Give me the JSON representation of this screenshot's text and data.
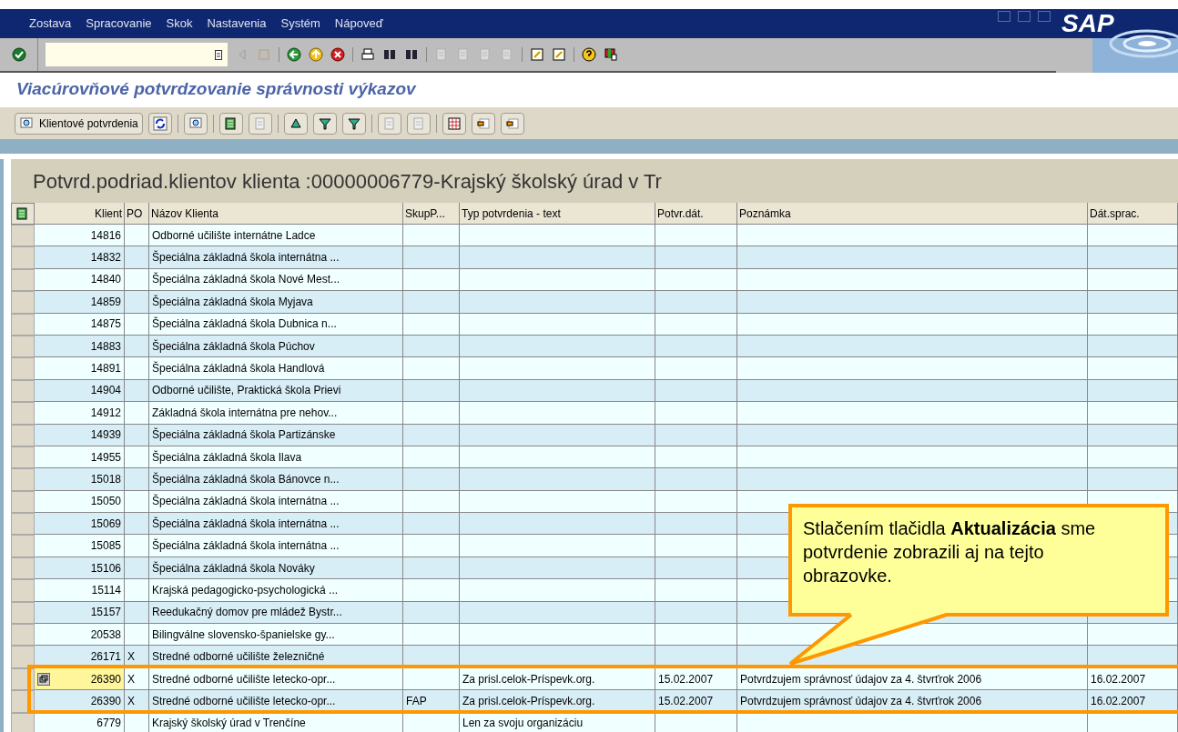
{
  "menu_bar": {
    "items": [
      "Zostava",
      "Spracovanie",
      "Skok",
      "Nastavenia",
      "Systém",
      "Nápoveď"
    ]
  },
  "logo": {
    "text": "SAP"
  },
  "screen_title": "Viacúrovňové potvrdzovanie správnosti výkazov",
  "app_toolbar": {
    "button_label": "Klientové potvrdenia"
  },
  "grid": {
    "title": "Potvrd.podriad.klientov klienta :00000006779-Krajský školský úrad v Tr",
    "columns": [
      "Klient",
      "PO",
      "Názov Klienta",
      "SkupP...",
      "Typ potvrdenia - text",
      "Potvr.dát.",
      "Poznámka",
      "Dát.sprac."
    ],
    "rows": [
      {
        "cells": [
          "14816",
          "",
          "Odborné učilište internátne Ladce",
          "",
          "",
          "",
          "",
          ""
        ],
        "current": false
      },
      {
        "cells": [
          "14832",
          "",
          "Špeciálna základná škola internátna ...",
          "",
          "",
          "",
          "",
          ""
        ],
        "current": false
      },
      {
        "cells": [
          "14840",
          "",
          "Špeciálna základná škola Nové Mest...",
          "",
          "",
          "",
          "",
          ""
        ],
        "current": false
      },
      {
        "cells": [
          "14859",
          "",
          "Špeciálna základná škola Myjava",
          "",
          "",
          "",
          "",
          ""
        ],
        "current": false
      },
      {
        "cells": [
          "14875",
          "",
          "Špeciálna základná škola Dubnica n...",
          "",
          "",
          "",
          "",
          ""
        ],
        "current": false
      },
      {
        "cells": [
          "14883",
          "",
          "Špeciálna základná škola Púchov",
          "",
          "",
          "",
          "",
          ""
        ],
        "current": false
      },
      {
        "cells": [
          "14891",
          "",
          "Špeciálna základná škola Handlová",
          "",
          "",
          "",
          "",
          ""
        ],
        "current": false
      },
      {
        "cells": [
          "14904",
          "",
          "Odborné učilište, Praktická škola Prievi",
          "",
          "",
          "",
          "",
          ""
        ],
        "current": false
      },
      {
        "cells": [
          "14912",
          "",
          "Základná škola internátna pre nehov...",
          "",
          "",
          "",
          "",
          ""
        ],
        "current": false
      },
      {
        "cells": [
          "14939",
          "",
          "Špeciálna základná škola Partizánske",
          "",
          "",
          "",
          "",
          ""
        ],
        "current": false
      },
      {
        "cells": [
          "14955",
          "",
          "Špeciálna základná škola Ilava",
          "",
          "",
          "",
          "",
          ""
        ],
        "current": false
      },
      {
        "cells": [
          "15018",
          "",
          "Špeciálna základná škola Bánovce n...",
          "",
          "",
          "",
          "",
          ""
        ],
        "current": false
      },
      {
        "cells": [
          "15050",
          "",
          "Špeciálna základná škola internátna ...",
          "",
          "",
          "",
          "",
          ""
        ],
        "current": false
      },
      {
        "cells": [
          "15069",
          "",
          "Špeciálna základná škola internátna ...",
          "",
          "",
          "",
          "",
          ""
        ],
        "current": false
      },
      {
        "cells": [
          "15085",
          "",
          "Špeciálna základná škola internátna ...",
          "",
          "",
          "",
          "",
          ""
        ],
        "current": false
      },
      {
        "cells": [
          "15106",
          "",
          "Špeciálna základná škola Nováky",
          "",
          "",
          "",
          "",
          ""
        ],
        "current": false
      },
      {
        "cells": [
          "15114",
          "",
          "Krajská pedagogicko-psychologická ...",
          "",
          "",
          "",
          "",
          ""
        ],
        "current": false
      },
      {
        "cells": [
          "15157",
          "",
          "Reedukačný domov pre mládež Bystr...",
          "",
          "",
          "",
          "",
          ""
        ],
        "current": false
      },
      {
        "cells": [
          "20538",
          "",
          "Bilingválne slovensko-španielske gy...",
          "",
          "",
          "",
          "",
          ""
        ],
        "current": false
      },
      {
        "cells": [
          "26171",
          "X",
          "Stredné odborné učilište železničné",
          "",
          "",
          "",
          "",
          ""
        ],
        "current": false
      },
      {
        "cells": [
          "26390",
          "X",
          "Stredné odborné učilište letecko-opr...",
          "",
          "Za prisl.celok-Príspevk.org.",
          "15.02.2007",
          "Potvrdzujem správnosť údajov za 4. štvrťrok 2006",
          "16.02.2007"
        ],
        "current": true
      },
      {
        "cells": [
          "26390",
          "X",
          "Stredné odborné učilište letecko-opr...",
          "FAP",
          "Za prisl.celok-Príspevk.org.",
          "15.02.2007",
          "Potvrdzujem správnosť údajov za 4. štvrťrok 2006",
          "16.02.2007"
        ],
        "current": false
      },
      {
        "cells": [
          "6779",
          "",
          "Krajský školský úrad v Trenčíne",
          "",
          "Len za svoju organizáciu",
          "",
          "",
          ""
        ],
        "current": false
      }
    ]
  },
  "callout": {
    "text": "Stlačením tlačidla **Aktualizácia** sme potvrdenie zobrazili aj na tejto obrazovke."
  }
}
